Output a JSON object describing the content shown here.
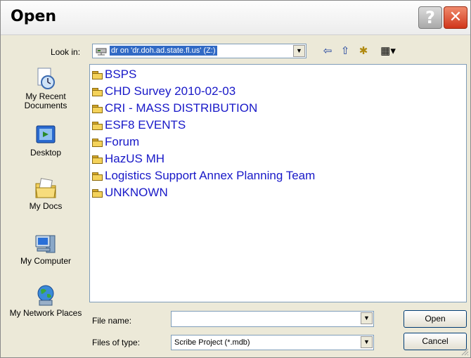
{
  "window": {
    "title": "Open",
    "help_glyph": "?",
    "close_glyph": "✕"
  },
  "lookin": {
    "label": "Look in:",
    "value": "dr on 'dr.doh.ad.state.fl.us' (Z:)"
  },
  "toolbar": {
    "back_glyph": "⇦",
    "up_glyph": "⇧",
    "newfolder_glyph": "✱",
    "views_glyph": "▦▾"
  },
  "places": [
    {
      "label": "My Recent Documents",
      "icon": "recent-documents-icon"
    },
    {
      "label": "Desktop",
      "icon": "desktop-icon"
    },
    {
      "label": "My Docs",
      "icon": "my-docs-icon"
    },
    {
      "label": "My Computer",
      "icon": "my-computer-icon"
    },
    {
      "label": "My Network Places",
      "icon": "network-places-icon"
    }
  ],
  "files": [
    "BSPS",
    "CHD Survey 2010-02-03",
    "CRI - MASS DISTRIBUTION",
    "ESF8 EVENTS",
    "Forum",
    "HazUS MH",
    "Logistics Support Annex Planning Team",
    "UNKNOWN"
  ],
  "filename": {
    "label": "File name:",
    "value": ""
  },
  "filetype": {
    "label": "Files of type:",
    "value": "Scribe Project (*.mdb)"
  },
  "buttons": {
    "open": "Open",
    "cancel": "Cancel"
  },
  "colors": {
    "accent": "#316ac5",
    "file_text": "#1818c8",
    "window_bg": "#ece9d8"
  }
}
